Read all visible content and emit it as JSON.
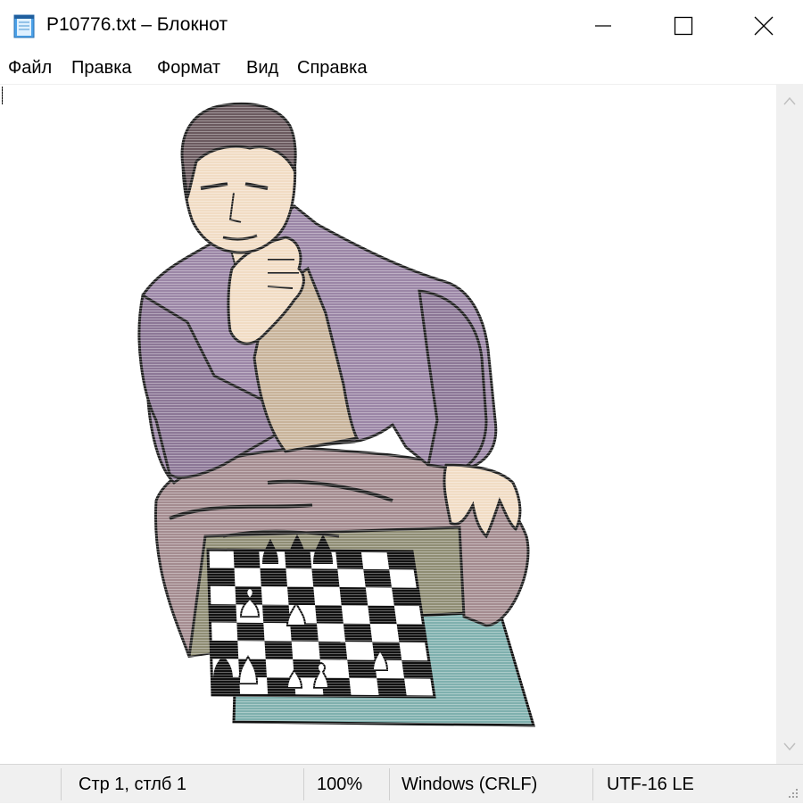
{
  "window": {
    "title": "P10776.txt – Блокнот",
    "icon": "notepad-icon"
  },
  "window_controls": {
    "minimize_icon": "minimize-icon",
    "maximize_icon": "maximize-icon",
    "close_icon": "close-icon"
  },
  "menu": {
    "items": [
      "Файл",
      "Правка",
      "Формат",
      "Вид",
      "Справка"
    ]
  },
  "editor": {
    "content_kind": "ascii-art illustration: man pondering over a chess board",
    "colors": {
      "jacket": "#9b86a6",
      "shirt": "#c8b39a",
      "skin": "#f1dcc4",
      "hair": "#6b5a5f",
      "trousers": "#a48c90",
      "board_back": "#8f8d74",
      "board_front": "#7fb0ae"
    }
  },
  "scrollbar": {
    "up_icon": "chevron-up-icon",
    "down_icon": "chevron-down-icon"
  },
  "status": {
    "position": "Стр 1, стлб 1",
    "zoom": "100%",
    "line_endings": "Windows (CRLF)",
    "encoding": "UTF-16 LE",
    "grip_icon": "resize-grip-icon"
  }
}
